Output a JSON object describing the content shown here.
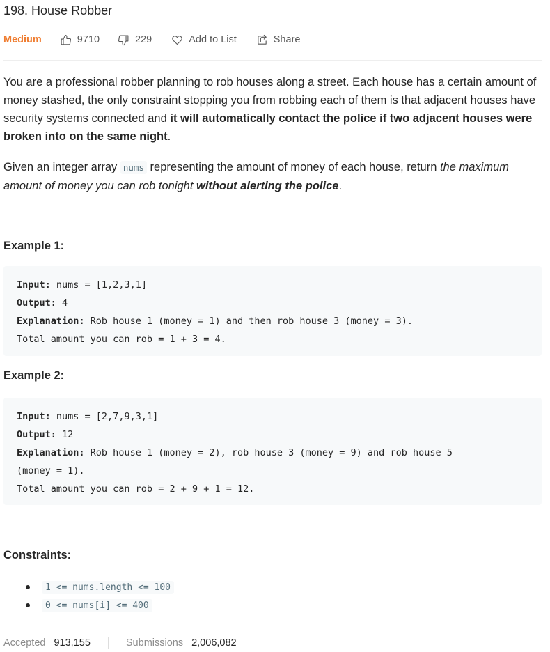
{
  "problem": {
    "title": "198. House Robber",
    "difficulty": "Medium",
    "likes": "9710",
    "dislikes": "229",
    "add_to_list": "Add to List",
    "share": "Share"
  },
  "description": {
    "p1_text": "You are a professional robber planning to rob houses along a street. Each house has a certain amount of money stashed, the only constraint stopping you from robbing each of them is that adjacent houses have security systems connected and ",
    "p1_bold": "it will automatically contact the police if two adjacent houses were broken into on the same night",
    "p1_end": ".",
    "p2_text": "Given an integer array ",
    "p2_code": "nums",
    "p2_mid": " representing the amount of money of each house, return ",
    "p2_italic": "the maximum amount of money you can rob tonight ",
    "p2_bold_italic": "without alerting the police",
    "p2_end": "."
  },
  "examples": [
    {
      "heading": "Example 1:",
      "input_label": "Input:",
      "input_value": " nums = [1,2,3,1]",
      "output_label": "Output:",
      "output_value": " 4",
      "explanation_label": "Explanation:",
      "explanation_line1": " Rob house 1 (money = 1) and then rob house 3 (money = 3).",
      "explanation_line2": "Total amount you can rob = 1 + 3 = 4."
    },
    {
      "heading": "Example 2:",
      "input_label": "Input:",
      "input_value": " nums = [2,7,9,3,1]",
      "output_label": "Output:",
      "output_value": " 12",
      "explanation_label": "Explanation:",
      "explanation_line1": " Rob house 1 (money = 2), rob house 3 (money = 9) and rob house 5",
      "explanation_line2": "(money = 1).",
      "explanation_line3": "Total amount you can rob = 2 + 9 + 1 = 12."
    }
  ],
  "constraints": {
    "heading": "Constraints:",
    "items": [
      "1 <= nums.length <= 100",
      "0 <= nums[i] <= 400"
    ]
  },
  "stats": {
    "accepted_label": "Accepted",
    "accepted_value": "913,155",
    "submissions_label": "Submissions",
    "submissions_value": "2,006,082"
  },
  "colors": {
    "difficulty_medium": "#ef7d31",
    "text": "#262626",
    "muted": "#595959",
    "code_bg": "#f7f9fa"
  },
  "icons": [
    "thumbs-up-icon",
    "thumbs-down-icon",
    "heart-icon",
    "share-icon"
  ]
}
